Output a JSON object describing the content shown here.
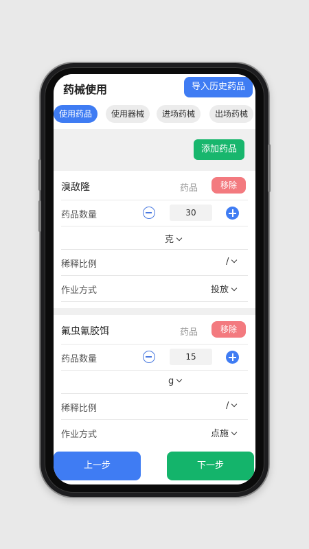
{
  "header": {
    "title": "药械使用",
    "import_label": "导入历史药品"
  },
  "tabs": [
    {
      "label": "使用药品",
      "active": true
    },
    {
      "label": "使用器械",
      "active": false
    },
    {
      "label": "进场药械",
      "active": false
    },
    {
      "label": "出场药械",
      "active": false
    }
  ],
  "add_label": "添加药品",
  "items": [
    {
      "name": "溴敌隆",
      "type": "药品",
      "remove_label": "移除",
      "qty_label": "药品数量",
      "qty_value": "30",
      "unit": "克",
      "dilution_label": "稀释比例",
      "dilution_value": "/",
      "method_label": "作业方式",
      "method_value": "投放"
    },
    {
      "name": "氟虫氰胶饵",
      "type": "药品",
      "remove_label": "移除",
      "qty_label": "药品数量",
      "qty_value": "15",
      "unit": "g",
      "dilution_label": "稀释比例",
      "dilution_value": "/",
      "method_label": "作业方式",
      "method_value": "点施"
    }
  ],
  "footer": {
    "prev_label": "上一步",
    "next_label": "下一步"
  },
  "colors": {
    "primary": "#3f7cf3",
    "success": "#18b66d",
    "danger": "#f37a7f"
  }
}
